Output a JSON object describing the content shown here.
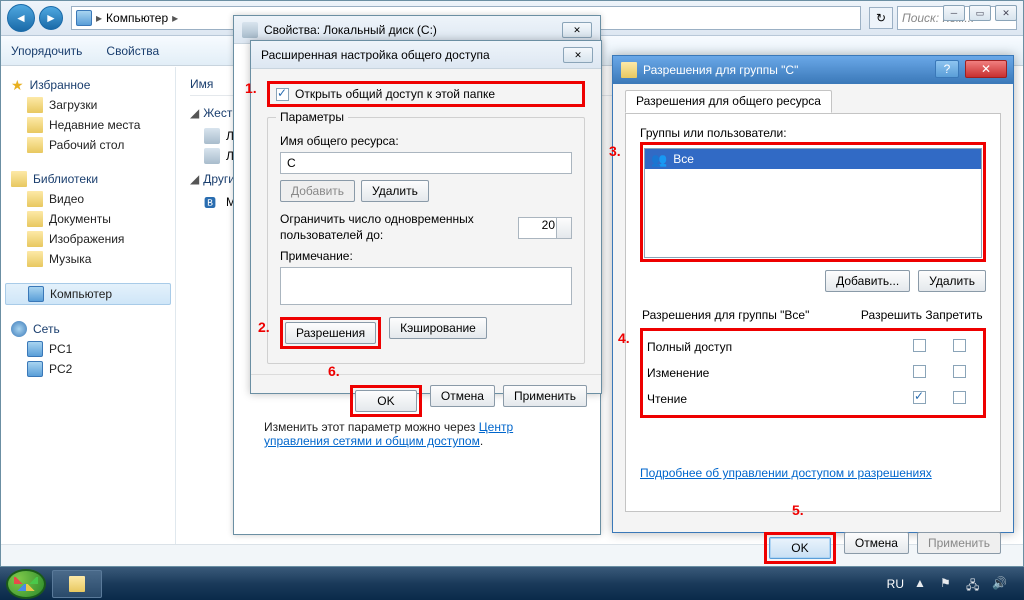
{
  "explorer": {
    "breadcrumb": "Компьютер",
    "search_placeholder": "Поиск: Ком...",
    "toolbar": {
      "organize": "Упорядочить",
      "properties": "Свойства"
    },
    "sidebar": {
      "favorites": {
        "head": "Избранное",
        "items": [
          "Загрузки",
          "Недавние места",
          "Рабочий стол"
        ]
      },
      "libraries": {
        "head": "Библиотеки",
        "items": [
          "Видео",
          "Документы",
          "Изображения",
          "Музыка"
        ]
      },
      "computer": {
        "head": "Компьютер"
      },
      "network": {
        "head": "Сеть",
        "items": [
          "PC1",
          "PC2"
        ]
      }
    },
    "main": {
      "col_name": "Имя",
      "group1": "Жесткие диски",
      "group2": "Другие",
      "drives": [
        "Локальный диск (C:)",
        "Локальный диск"
      ],
      "other": [
        "My Bluetooth"
      ]
    }
  },
  "props": {
    "title": "Свойства: Локальный диск (C:)",
    "footer_text_a": "Изменить этот параметр можно через ",
    "footer_link": "Центр управления сетями и общим доступом",
    "footer_text_b": "."
  },
  "adv": {
    "title": "Расширенная настройка общего доступа",
    "share_check": "Открыть общий доступ к этой папке",
    "share_checked": true,
    "params_legend": "Параметры",
    "share_name_label": "Имя общего ресурса:",
    "share_name": "C",
    "add": "Добавить",
    "remove": "Удалить",
    "limit_label": "Ограничить число одновременных пользователей до:",
    "limit_value": "20",
    "note_label": "Примечание:",
    "permissions": "Разрешения",
    "caching": "Кэширование",
    "ok": "OK",
    "cancel": "Отмена",
    "apply": "Применить"
  },
  "perm": {
    "title": "Разрешения для группы \"C\"",
    "tab": "Разрешения для общего ресурса",
    "groups_label": "Группы или пользователи:",
    "groups": [
      "Все"
    ],
    "add": "Добавить...",
    "remove": "Удалить",
    "perms_for": "Разрешения для группы \"Все\"",
    "col_allow": "Разрешить",
    "col_deny": "Запретить",
    "rows": [
      {
        "name": "Полный доступ",
        "allow": false,
        "deny": false
      },
      {
        "name": "Изменение",
        "allow": false,
        "deny": false
      },
      {
        "name": "Чтение",
        "allow": true,
        "deny": false
      }
    ],
    "more_link": "Подробнее об управлении доступом и разрешениях",
    "ok": "OK",
    "cancel": "Отмена",
    "apply": "Применить"
  },
  "ann": {
    "n1": "1.",
    "n2": "2.",
    "n3": "3.",
    "n4": "4.",
    "n5": "5.",
    "n6": "6."
  },
  "taskbar": {
    "lang": "RU"
  }
}
